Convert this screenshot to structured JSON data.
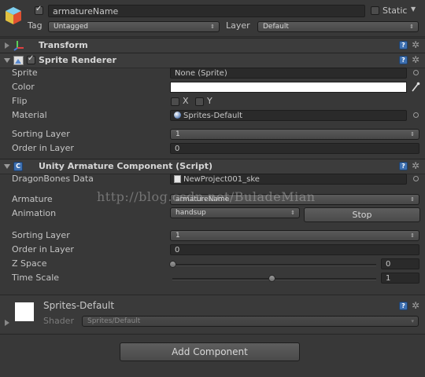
{
  "object": {
    "name": "armatureName",
    "static_label": "Static",
    "tag_label": "Tag",
    "tag_value": "Untagged",
    "layer_label": "Layer",
    "layer_value": "Default"
  },
  "transform": {
    "title": "Transform"
  },
  "sprite_renderer": {
    "title": "Sprite Renderer",
    "sprite_label": "Sprite",
    "sprite_value": "None (Sprite)",
    "color_label": "Color",
    "color_value": "#ffffff",
    "flip_label": "Flip",
    "flip_x": "X",
    "flip_y": "Y",
    "material_label": "Material",
    "material_value": "Sprites-Default",
    "sorting_layer_label": "Sorting Layer",
    "sorting_layer_value": "1",
    "order_label": "Order in Layer",
    "order_value": "0"
  },
  "armature": {
    "title": "Unity Armature Component (Script)",
    "db_label": "DragonBones Data",
    "db_value": "NewProject001_ske",
    "armature_label": "Armature",
    "armature_value": "armatureName",
    "animation_label": "Animation",
    "animation_value": "handsup",
    "stop_label": "Stop",
    "sorting_layer_label": "Sorting Layer",
    "sorting_layer_value": "1",
    "order_label": "Order in Layer",
    "order_value": "0",
    "zspace_label": "Z Space",
    "zspace_value": "0",
    "zspace_fraction": 0.0,
    "timescale_label": "Time Scale",
    "timescale_value": "1",
    "timescale_fraction": 0.5
  },
  "material_footer": {
    "name": "Sprites-Default",
    "shader_label": "Shader",
    "shader_value": "Sprites/Default"
  },
  "add_component_label": "Add Component",
  "watermark": "http://blog.csdn.net/BuladeMian",
  "icons": {
    "help": "help-icon",
    "gear": "gear-icon",
    "object_picker": "object-picker-icon",
    "eyedropper": "eyedropper-icon"
  }
}
